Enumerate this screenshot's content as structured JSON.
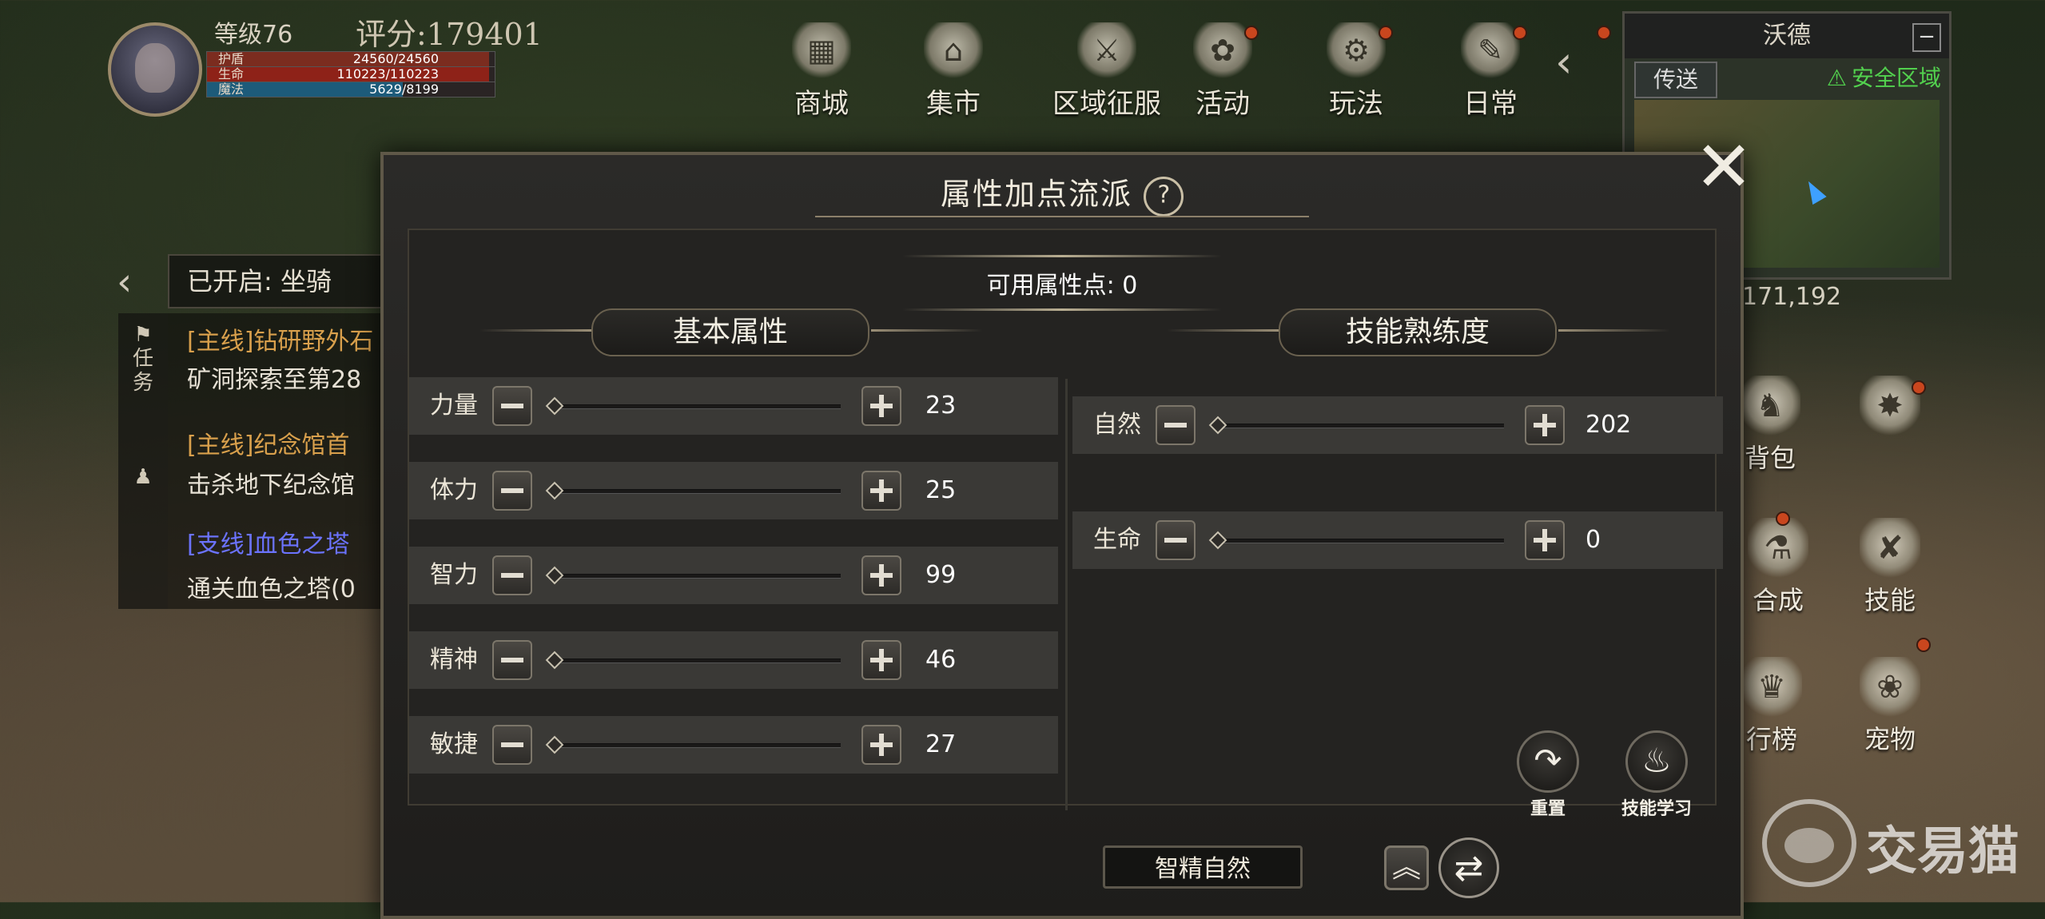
{
  "hud": {
    "level": "等级76",
    "score": "评分:179401",
    "bars": {
      "hp": {
        "label": "护盾",
        "value": "24560/24560"
      },
      "life": {
        "label": "生命",
        "value": "110223/110223"
      },
      "mana": {
        "label": "魔法",
        "value": "5629/8199"
      }
    }
  },
  "top_menu": [
    "商城",
    "集市",
    "区域征服",
    "活动",
    "玩法",
    "日常"
  ],
  "minimap": {
    "title": "沃德",
    "teleport": "传送",
    "safe_zone": "安全区域",
    "coords": "171,192"
  },
  "quests": {
    "opened": "已开启: 坐骑",
    "tab_task": "任务",
    "items": [
      {
        "title": "[主线]钻研野外石",
        "desc": "矿洞探索至第28"
      },
      {
        "title": "[主线]纪念馆首",
        "desc": "击杀地下纪念馆"
      },
      {
        "title": "[支线]血色之塔",
        "desc": "通关血色之塔(0"
      }
    ]
  },
  "side_icons": [
    "背包",
    "合成",
    "技能",
    "行榜",
    "宠物"
  ],
  "dialog": {
    "title": "属性加点流派",
    "help_icon": "?",
    "close": "✕",
    "available_points": "可用属性点: 0",
    "basic_header": "基本属性",
    "skill_header": "技能熟练度",
    "basic_attributes": [
      {
        "label": "力量",
        "value": "23"
      },
      {
        "label": "体力",
        "value": "25"
      },
      {
        "label": "智力",
        "value": "99"
      },
      {
        "label": "精神",
        "value": "46"
      },
      {
        "label": "敏捷",
        "value": "27"
      }
    ],
    "skill_proficiency": [
      {
        "label": "自然",
        "value": "202"
      },
      {
        "label": "生命",
        "value": "0"
      }
    ],
    "reset_label": "重置",
    "learn_label": "技能学习",
    "preset_name": "智精自然"
  },
  "watermark": "交易猫"
}
